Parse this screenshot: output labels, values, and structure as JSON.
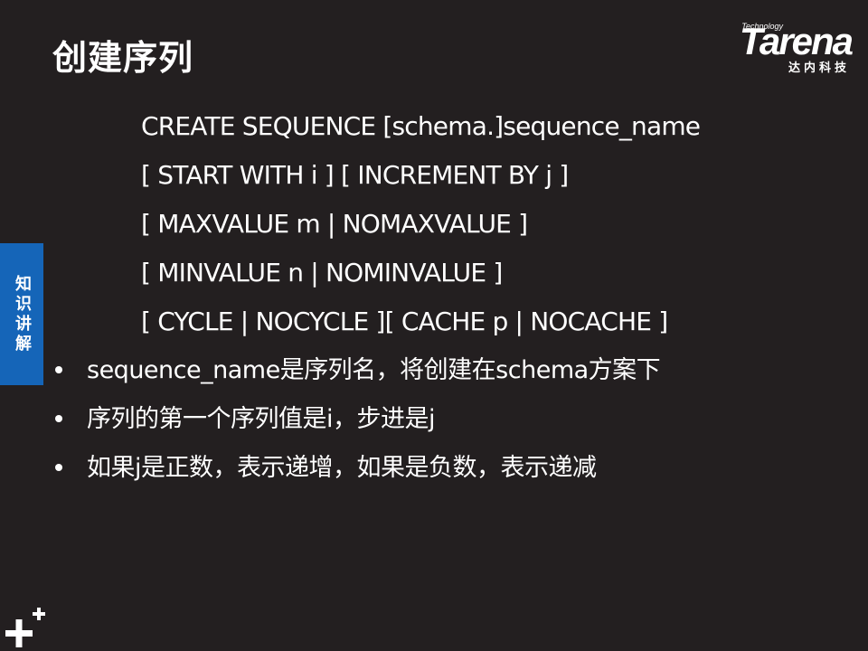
{
  "slide": {
    "title": "创建序列",
    "logo": {
      "wordmark": "Tarena",
      "tagline": "Technology",
      "chinese_name": "达内科技"
    },
    "side_tab": "知识讲解",
    "syntax_lines": [
      "CREATE SEQUENCE [schema.]sequence_name",
      "[ START WITH i ] [ INCREMENT BY j ]",
      "[ MAXVALUE m | NOMAXVALUE ]",
      "[ MINVALUE n | NOMINVALUE ]",
      "[ CYCLE | NOCYCLE ][ CACHE p | NOCACHE ]"
    ],
    "bullets": [
      "sequence_name是序列名，将创建在schema方案下",
      "序列的第一个序列值是i，步进是j",
      "如果j是正数，表示递增，如果是负数，表示递减"
    ]
  },
  "colors": {
    "background": "#231f20",
    "text": "#ffffff",
    "side_tab": "#1565b8"
  },
  "icons": {
    "corner": "plus-icon"
  }
}
